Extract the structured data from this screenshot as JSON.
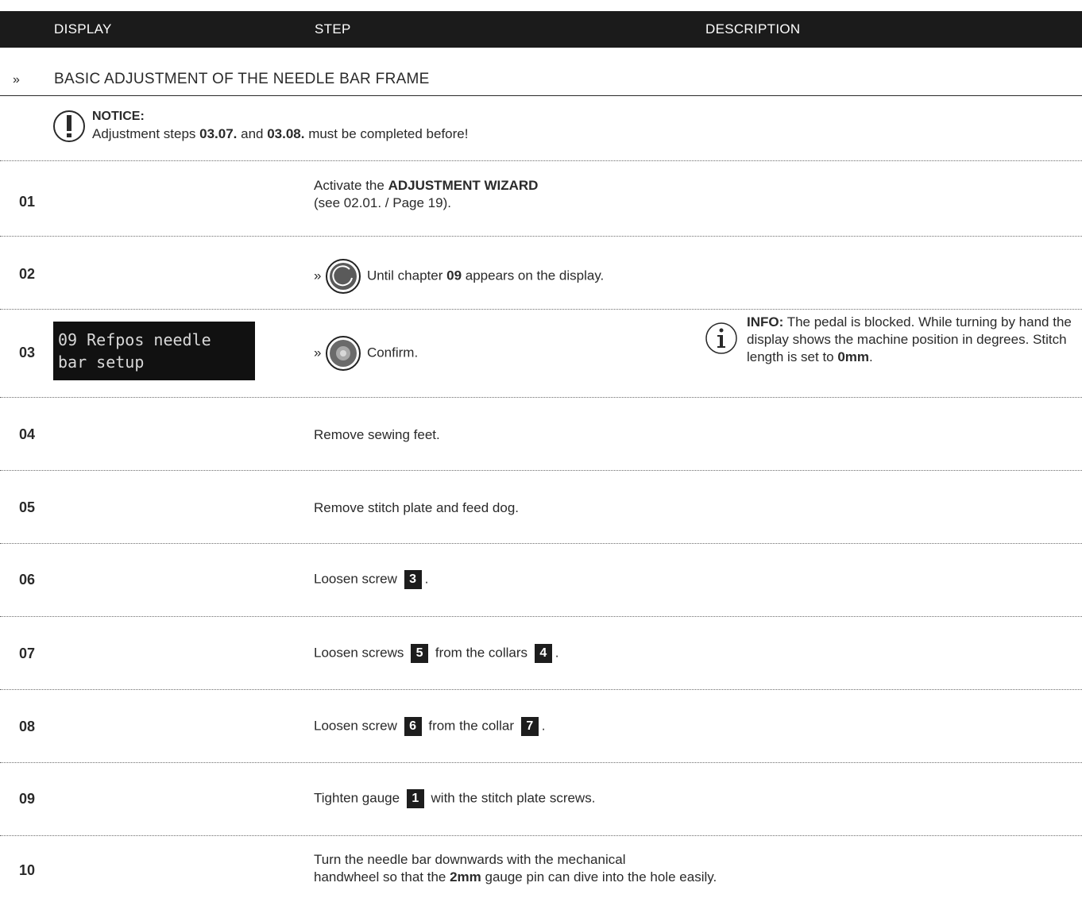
{
  "header": {
    "display": "DISPLAY",
    "step": "STEP",
    "description": "DESCRIPTION"
  },
  "section": {
    "arrow": "»",
    "title": "BASIC ADJUSTMENT OF THE NEEDLE BAR FRAME"
  },
  "notice": {
    "title": "NOTICE:",
    "body_pre": "Adjustment steps ",
    "step_a": "03.07.",
    "body_mid": " and ",
    "step_b": "03.08.",
    "body_post": " must be completed before!"
  },
  "steps": [
    {
      "num": "01",
      "pre": "Activate the ",
      "bold": "ADJUSTMENT WIZARD",
      "line2": "(see 02.01. / Page 19)."
    },
    {
      "num": "02",
      "prefix": "»",
      "icon": "rotate-knob-icon",
      "pre": "Until chapter ",
      "bold": "09",
      "post": " appears on the display."
    },
    {
      "num": "03",
      "prefix": "»",
      "icon": "confirm-knob-icon",
      "text": "Confirm.",
      "display": {
        "line1": "09 Refpos needle",
        "line2": "bar setup"
      },
      "info": {
        "label": "INFO:",
        "text": " The pedal is blocked. While turning by hand the display shows the machine position in degrees. Stitch length is set to ",
        "bold": "0mm",
        "end": "."
      }
    },
    {
      "num": "04",
      "text": "Remove sewing feet."
    },
    {
      "num": "05",
      "text": "Remove stitch plate and feed dog."
    },
    {
      "num": "06",
      "pre": "Loosen screw ",
      "tag1": "3",
      "post": "."
    },
    {
      "num": "07",
      "pre": "Loosen screws ",
      "tag1": "5",
      "mid": " from the collars ",
      "tag2": "4",
      "post": "."
    },
    {
      "num": "08",
      "pre": "Loosen screw ",
      "tag1": "6",
      "mid": " from the collar ",
      "tag2": "7",
      "post": "."
    },
    {
      "num": "09",
      "pre": "Tighten gauge ",
      "tag1": "1",
      "post": " with the stitch plate screws."
    },
    {
      "num": "10",
      "line1": "Turn the needle bar downwards with the mechanical",
      "pre": "handwheel so that the ",
      "bold": "2mm",
      "post": " gauge pin can dive into the hole easily."
    }
  ]
}
